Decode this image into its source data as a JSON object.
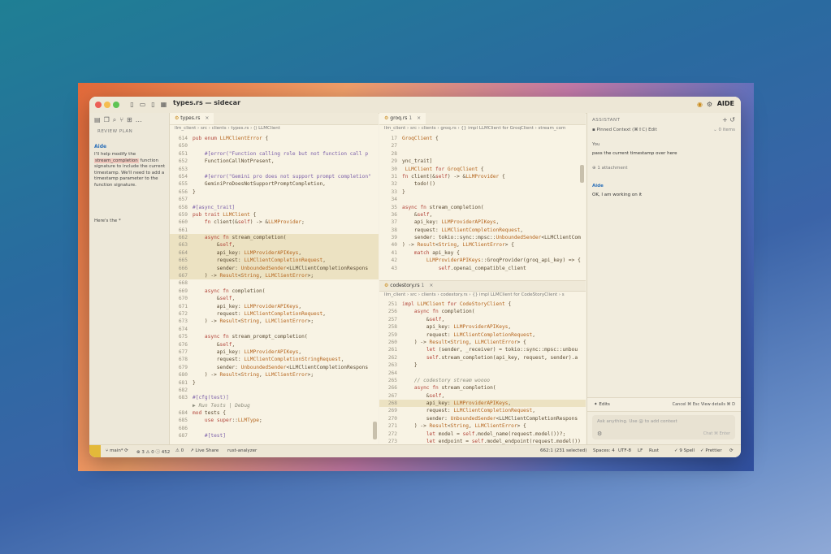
{
  "window": {
    "title": "types.rs — sidecar",
    "brand": "AIDE"
  },
  "colors": {
    "accent": "#2a6fb8",
    "highlight": "#f1c8bd",
    "editor_bg": "#f8f3e4"
  },
  "sidebar": {
    "section_title": "REVIEW PLAN",
    "agent_name": "Aide",
    "message_pre": "I'll help modify the ",
    "message_code": "stream_completion",
    "message_post": " function signature to include the current timestamp. We'll need to add a timestamp parameter to the function signature.",
    "message2": "Here's the *"
  },
  "editor1": {
    "tab": "types.rs",
    "breadcrumb": "llm_client  ›  src  ›  clients  ›  types.rs  ›  ⟨⟩ LLMClient",
    "lines": [
      {
        "n": "614",
        "t": "pub enum LLMClientError {"
      },
      {
        "n": "650",
        "t": ""
      },
      {
        "n": "651",
        "t": "    #[error(\"Function calling role but not function call p"
      },
      {
        "n": "652",
        "t": "    FunctionCallNotPresent,"
      },
      {
        "n": "653",
        "t": ""
      },
      {
        "n": "654",
        "t": "    #[error(\"Gemini pro does not support prompt completion\""
      },
      {
        "n": "655",
        "t": "    GeminiProDoesNotSupportPromptCompletion,"
      },
      {
        "n": "656",
        "t": "}"
      },
      {
        "n": "657",
        "t": ""
      },
      {
        "n": "658",
        "t": "#[async_trait]"
      },
      {
        "n": "659",
        "t": "pub trait LLMClient {"
      },
      {
        "n": "660",
        "t": "    fn client(&self) -> &LLMProvider;"
      },
      {
        "n": "661",
        "t": ""
      },
      {
        "n": "662",
        "t": "    async fn stream_completion("
      },
      {
        "n": "663",
        "t": "        &self,"
      },
      {
        "n": "664",
        "t": "        api_key: LLMProviderAPIKeys,"
      },
      {
        "n": "665",
        "t": "        request: LLMClientCompletionRequest,"
      },
      {
        "n": "666",
        "t": "        sender: UnboundedSender<LLMClientCompletionRespons"
      },
      {
        "n": "667",
        "t": "    ) -> Result<String, LLMClientError>;"
      },
      {
        "n": "668",
        "t": ""
      },
      {
        "n": "669",
        "t": "    async fn completion("
      },
      {
        "n": "670",
        "t": "        &self,"
      },
      {
        "n": "671",
        "t": "        api_key: LLMProviderAPIKeys,"
      },
      {
        "n": "672",
        "t": "        request: LLMClientCompletionRequest,"
      },
      {
        "n": "673",
        "t": "    ) -> Result<String, LLMClientError>;"
      },
      {
        "n": "674",
        "t": ""
      },
      {
        "n": "675",
        "t": "    async fn stream_prompt_completion("
      },
      {
        "n": "676",
        "t": "        &self,"
      },
      {
        "n": "677",
        "t": "        api_key: LLMProviderAPIKeys,"
      },
      {
        "n": "678",
        "t": "        request: LLMClientCompletionStringRequest,"
      },
      {
        "n": "679",
        "t": "        sender: UnboundedSender<LLMClientCompletionRespons"
      },
      {
        "n": "680",
        "t": "    ) -> Result<String, LLMClientError>;"
      },
      {
        "n": "681",
        "t": "}"
      },
      {
        "n": "682",
        "t": ""
      },
      {
        "n": "683",
        "t": "#[cfg(test)]"
      },
      {
        "n": "",
        "t": "▶ Run Tests | Debug"
      },
      {
        "n": "684",
        "t": "mod tests {"
      },
      {
        "n": "685",
        "t": "    use super::LLMType;"
      },
      {
        "n": "686",
        "t": ""
      },
      {
        "n": "687",
        "t": "    #[test]"
      }
    ]
  },
  "editor2": {
    "tab": "groq.rs",
    "tab_badge": "1",
    "breadcrumb": "llm_client  ›  src  ›  clients  ›  groq.rs  ›  {} impl LLMClient for GroqClient  ›  stream_com",
    "lines": [
      {
        "n": "17",
        "t": "GroqClient {"
      },
      {
        "n": "27",
        "t": ""
      },
      {
        "n": "28",
        "t": ""
      },
      {
        "n": "29",
        "t": "ync_trait]"
      },
      {
        "n": "30",
        "t": " LLMClient for GroqClient {"
      },
      {
        "n": "31",
        "t": "fn client(&self) -> &LLMProvider {"
      },
      {
        "n": "32",
        "t": "    todo!()"
      },
      {
        "n": "33",
        "t": "}"
      },
      {
        "n": "34",
        "t": ""
      },
      {
        "n": "35",
        "t": "async fn stream_completion("
      },
      {
        "n": "36",
        "t": "    &self,"
      },
      {
        "n": "37",
        "t": "    api_key: LLMProviderAPIKeys,"
      },
      {
        "n": "38",
        "t": "    request: LLMClientCompletionRequest,"
      },
      {
        "n": "39",
        "t": "    sender: tokio::sync::mpsc::UnboundedSender<LLMClientCom"
      },
      {
        "n": "40",
        "t": ") -> Result<String, LLMClientError> {"
      },
      {
        "n": "41",
        "t": "    match api_key {"
      },
      {
        "n": "42",
        "t": "        LLMProviderAPIKeys::GroqProvider(groq_api_key) => {"
      },
      {
        "n": "43",
        "t": "            self.openai_compatible_client"
      }
    ]
  },
  "editor3": {
    "tab": "codestory.rs",
    "tab_badge": "1",
    "breadcrumb": "llm_client  ›  src  ›  clients  ›  codestory.rs  ›  {} impl LLMClient for CodeStoryClient  ›  s",
    "lines": [
      {
        "n": "251",
        "t": "impl LLMClient for CodeStoryClient {"
      },
      {
        "n": "256",
        "t": "    async fn completion("
      },
      {
        "n": "257",
        "t": "        &self,"
      },
      {
        "n": "258",
        "t": "        api_key: LLMProviderAPIKeys,"
      },
      {
        "n": "259",
        "t": "        request: LLMClientCompletionRequest,"
      },
      {
        "n": "260",
        "t": "    ) -> Result<String, LLMClientError> {"
      },
      {
        "n": "261",
        "t": "        let (sender, _receiver) = tokio::sync::mpsc::unbou"
      },
      {
        "n": "262",
        "t": "        self.stream_completion(api_key, request, sender).a"
      },
      {
        "n": "263",
        "t": "    }"
      },
      {
        "n": "264",
        "t": ""
      },
      {
        "n": "265",
        "t": "    // codestory stream woooo"
      },
      {
        "n": "266",
        "t": "    async fn stream_completion("
      },
      {
        "n": "267",
        "t": "        &self,"
      },
      {
        "n": "268",
        "t": "        api_key: LLMProviderAPIKeys,"
      },
      {
        "n": "269",
        "t": "        request: LLMClientCompletionRequest,"
      },
      {
        "n": "270",
        "t": "        sender: UnboundedSender<LLMClientCompletionRespons"
      },
      {
        "n": "271",
        "t": "    ) -> Result<String, LLMClientError> {"
      },
      {
        "n": "272",
        "t": "        let model = self.model_name(request.model())?;"
      },
      {
        "n": "273",
        "t": "        let endpoint = self.model_endpoint(request.model())"
      }
    ]
  },
  "assistant": {
    "header": "ASSISTANT",
    "pinned": "Pinned Context (⌘⇧C)   Edit",
    "pinned_count": "0 items",
    "you": "You",
    "user_msg": "pass the current timestamp over here",
    "attachment": "1 attachment",
    "aide": "Aide",
    "reply": "OK, I am working on it",
    "edits_label": "Edits",
    "edits_buttons": "Cancel  ⌘ Esc   View details  ⌘ D",
    "input_placeholder": "Ask anything. Use @ to add context",
    "input_tools": "Chat  ⌘ Enter"
  },
  "status": {
    "branch": "main*",
    "problems": "⊗ 3  ⚠ 0  ⓘ 452",
    "ports": "⚠ 0",
    "liveshare": "Live Share",
    "analyzer": "rust-analyzer",
    "position": "662:1 (231 selected)",
    "spaces": "Spaces: 4",
    "encoding": "UTF-8",
    "eol": "LF",
    "lang": "Rust",
    "spell": "9 Spell",
    "prettier": "Prettier"
  }
}
